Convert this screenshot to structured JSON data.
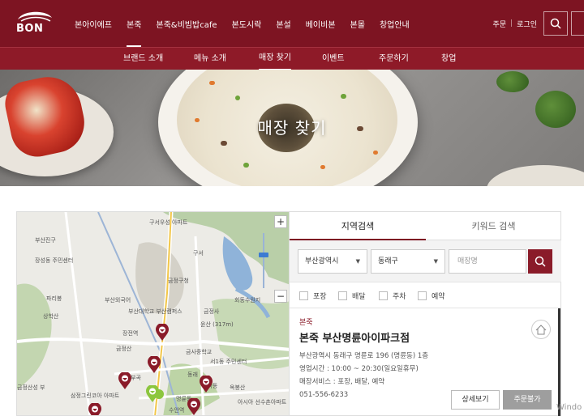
{
  "header": {
    "logo_text": "BON",
    "nav": [
      "본아이에프",
      "본죽",
      "본죽&비빔밥cafe",
      "본도시락",
      "본설",
      "베이비본",
      "본몰",
      "창업안내"
    ],
    "active_nav": "본죽",
    "util": {
      "order": "주문",
      "separator": "|",
      "login": "로그인"
    }
  },
  "subnav": {
    "items": [
      "브랜드 소개",
      "메뉴 소개",
      "매장 찾기",
      "이벤트",
      "주문하기",
      "창업"
    ],
    "active": "매장 찾기"
  },
  "hero": {
    "title": "매장 찾기"
  },
  "map": {
    "zoom_in": "+",
    "zoom_out": "−",
    "labels": [
      "구서우성 아파트",
      "구서",
      "부산진구",
      "금정구청",
      "부산대학교 부산캠퍼스",
      "금정사",
      "윤산 (317m)",
      "금사중학교",
      "장성동 주민센터",
      "부산외국어",
      "파리봉",
      "상학산",
      "금정산",
      "장전역",
      "서1동 주민센터",
      "안락동",
      "삼정그린코아 아파트",
      "부곡",
      "회동수원지",
      "옥봉산",
      "수안역",
      "아시아 선수촌아파트",
      "동래",
      "금정산성 부",
      "명륜동"
    ]
  },
  "search": {
    "tabs": [
      "지역검색",
      "키워드 검색"
    ],
    "active_tab": "지역검색",
    "city": "부산광역시",
    "district": "동래구",
    "store_placeholder": "매장명",
    "filters": [
      "포장",
      "배달",
      "주차",
      "예약"
    ]
  },
  "result": {
    "brand": "본죽",
    "store_name": "본죽 부산명륜아이파크점",
    "address": "부산광역시 동래구 명륜로 196 (명륜동) 1층",
    "hours": "영업시간 : 10:00 ~ 20:30(일요일휴무)",
    "services": "매장서비스 : 포장, 배달, 예약",
    "phone": "051-556-6233",
    "detail_btn": "상세보기",
    "order_btn": "주문불가"
  },
  "watermark": "Windo"
}
